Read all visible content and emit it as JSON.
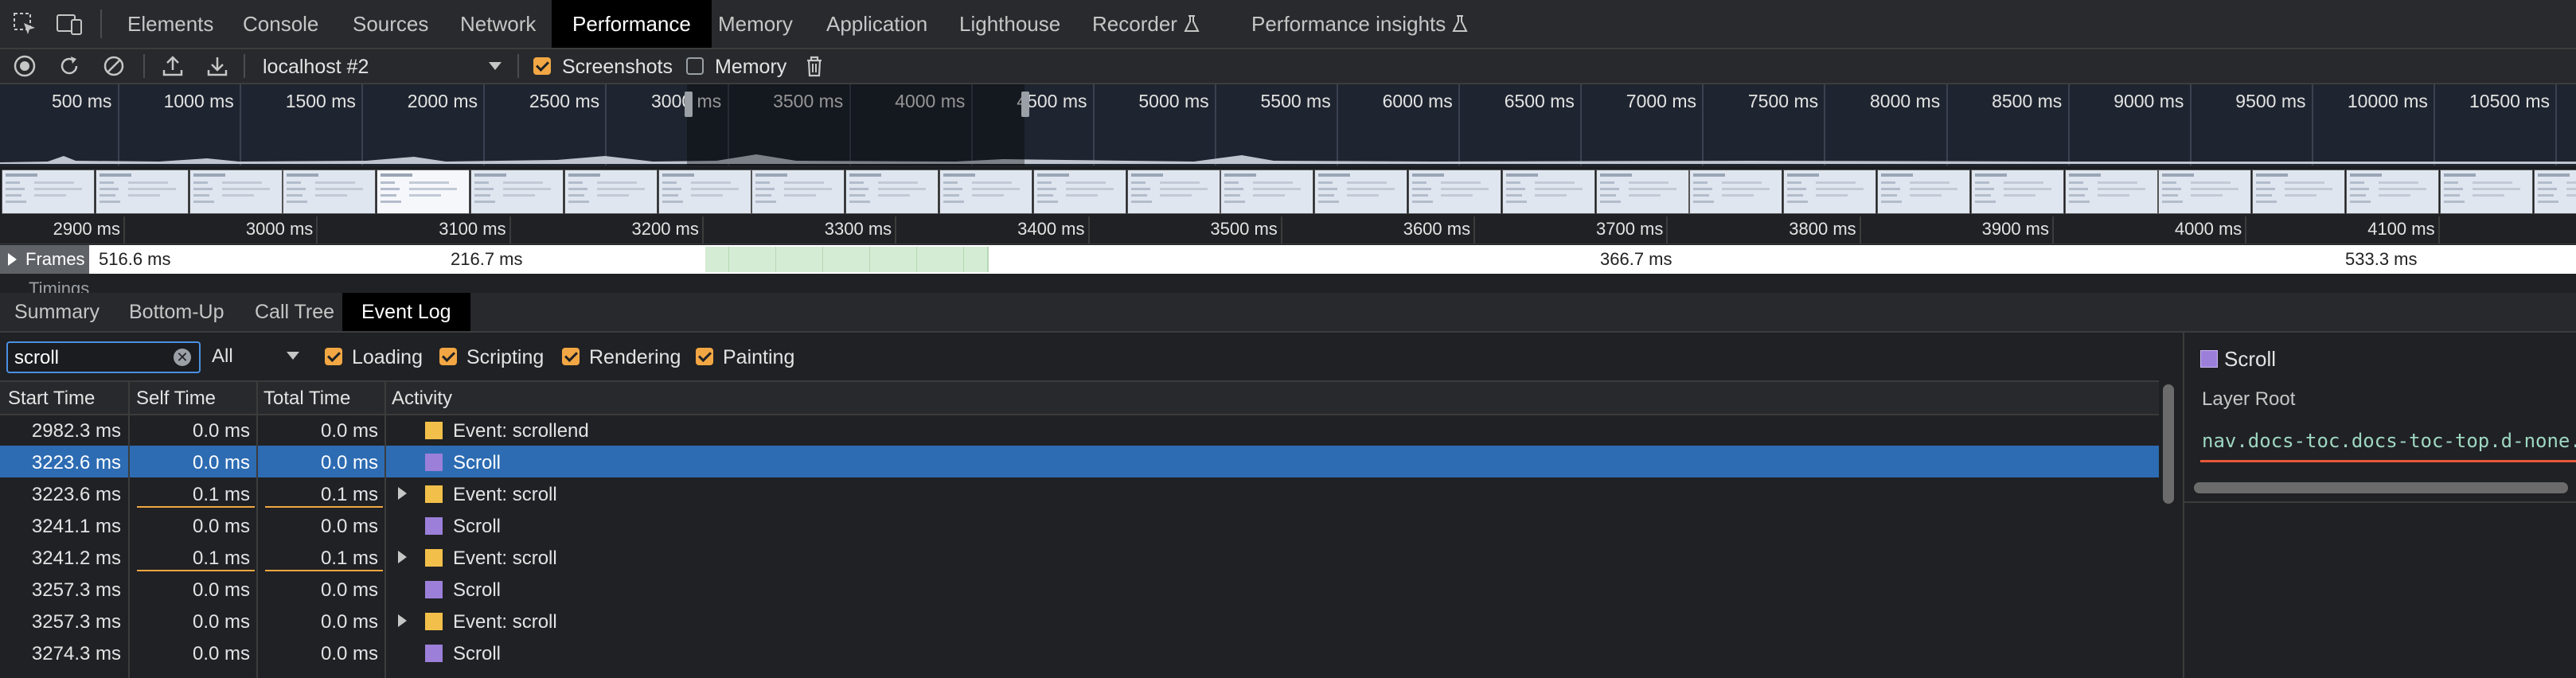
{
  "top_tabs": [
    "Elements",
    "Console",
    "Sources",
    "Network",
    "Performance",
    "Memory",
    "Application",
    "Lighthouse",
    "Recorder",
    "Performance insights"
  ],
  "toolbar": {
    "profile_select": "localhost #2",
    "screenshots_label": "Screenshots",
    "screenshots_checked": true,
    "memory_label": "Memory",
    "memory_checked": false
  },
  "overview_ticks": [
    "500 ms",
    "1000 ms",
    "1500 ms",
    "2000 ms",
    "2500 ms",
    "3000 ms",
    "3500 ms",
    "4000 ms",
    "4500 ms",
    "5000 ms",
    "5500 ms",
    "6000 ms",
    "6500 ms",
    "7000 ms",
    "7500 ms",
    "8000 ms",
    "8500 ms",
    "9000 ms",
    "9500 ms",
    "10000 ms",
    "10500 ms"
  ],
  "ruler_ticks": [
    "2900 ms",
    "3000 ms",
    "3100 ms",
    "3200 ms",
    "3300 ms",
    "3400 ms",
    "3500 ms",
    "3600 ms",
    "3700 ms",
    "3800 ms",
    "3900 ms",
    "4000 ms",
    "4100 ms"
  ],
  "frames": {
    "label": "Frames",
    "values": [
      "516.6 ms",
      "216.7 ms",
      "366.7 ms",
      "533.3 ms"
    ]
  },
  "timings_label": "Timings",
  "bottom_tabs": [
    "Summary",
    "Bottom-Up",
    "Call Tree",
    "Event Log"
  ],
  "filter": {
    "search_value": "scroll",
    "duration_select": "All",
    "categories": [
      {
        "label": "Loading",
        "checked": true
      },
      {
        "label": "Scripting",
        "checked": true
      },
      {
        "label": "Rendering",
        "checked": true
      },
      {
        "label": "Painting",
        "checked": true
      }
    ]
  },
  "table": {
    "headers": [
      "Start Time",
      "Self Time",
      "Total Time",
      "Activity"
    ],
    "rows": [
      {
        "start": "2982.3 ms",
        "self": "0.0 ms",
        "total": "0.0 ms",
        "activity": "Event: scrollend",
        "category": "scripting",
        "expandable": false,
        "selected": false
      },
      {
        "start": "3223.6 ms",
        "self": "0.0 ms",
        "total": "0.0 ms",
        "activity": "Scroll",
        "category": "rendering",
        "expandable": false,
        "selected": true
      },
      {
        "start": "3223.6 ms",
        "self": "0.1 ms",
        "total": "0.1 ms",
        "activity": "Event: scroll",
        "category": "scripting",
        "expandable": true,
        "selected": false
      },
      {
        "start": "3241.1 ms",
        "self": "0.0 ms",
        "total": "0.0 ms",
        "activity": "Scroll",
        "category": "rendering",
        "expandable": false,
        "selected": false
      },
      {
        "start": "3241.2 ms",
        "self": "0.1 ms",
        "total": "0.1 ms",
        "activity": "Event: scroll",
        "category": "scripting",
        "expandable": true,
        "selected": false
      },
      {
        "start": "3257.3 ms",
        "self": "0.0 ms",
        "total": "0.0 ms",
        "activity": "Scroll",
        "category": "rendering",
        "expandable": false,
        "selected": false
      },
      {
        "start": "3257.3 ms",
        "self": "0.0 ms",
        "total": "0.0 ms",
        "activity": "Event: scroll",
        "category": "scripting",
        "expandable": true,
        "selected": false
      },
      {
        "start": "3274.3 ms",
        "self": "0.0 ms",
        "total": "0.0 ms",
        "activity": "Scroll",
        "category": "rendering",
        "expandable": false,
        "selected": false
      }
    ]
  },
  "details": {
    "title": "Scroll",
    "layer_root_label": "Layer Root",
    "node_selector": "nav.docs-toc.docs-toc-top.d-none."
  },
  "colors": {
    "scripting": "#f2c04a",
    "rendering": "#9b7fd9",
    "accent": "#f2a744",
    "selection": "#2d6cb3"
  }
}
